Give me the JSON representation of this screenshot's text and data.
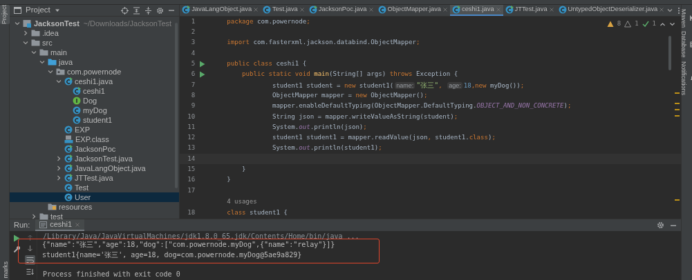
{
  "tool_stripes": {
    "left": [
      {
        "label": "Project",
        "selected": true
      }
    ],
    "bottom_left": "marks",
    "right": [
      {
        "label": "Maven",
        "kind": "maven"
      },
      {
        "label": "Database",
        "kind": "database"
      },
      {
        "label": "Notifications",
        "kind": "bell"
      }
    ]
  },
  "project_panel": {
    "title": "Project",
    "tree": [
      {
        "label": "JacksonTest",
        "path": "~/Downloads/JacksonTest",
        "kind": "module",
        "selected": false,
        "expanded": true,
        "children": [
          {
            "label": ".idea",
            "kind": "folder",
            "selected": false,
            "expanded": false
          },
          {
            "label": "src",
            "kind": "folder",
            "selected": false,
            "expanded": true,
            "children": [
              {
                "label": "main",
                "kind": "folder",
                "selected": false,
                "expanded": true,
                "children": [
                  {
                    "label": "java",
                    "kind": "source",
                    "selected": false,
                    "expanded": true,
                    "children": [
                      {
                        "label": "com.powernode",
                        "kind": "package",
                        "selected": false,
                        "expanded": true,
                        "children": [
                          {
                            "label": "ceshi1.java",
                            "kind": "runclass",
                            "selected": false,
                            "expanded": true,
                            "children": [
                              {
                                "label": "ceshi1",
                                "kind": "runclass",
                                "selected": false
                              },
                              {
                                "label": "Dog",
                                "kind": "interface",
                                "selected": false
                              },
                              {
                                "label": "myDog",
                                "kind": "class",
                                "selected": false
                              },
                              {
                                "label": "student1",
                                "kind": "class",
                                "selected": false
                              }
                            ]
                          },
                          {
                            "label": "EXP",
                            "kind": "class",
                            "selected": false
                          },
                          {
                            "label": "EXP.class",
                            "kind": "compiled",
                            "selected": false
                          },
                          {
                            "label": "JacksonPoc",
                            "kind": "runclass",
                            "selected": false
                          },
                          {
                            "label": "JacksonTest.java",
                            "kind": "runclass",
                            "selected": false,
                            "expanded": false
                          },
                          {
                            "label": "JavaLangObject.java",
                            "kind": "runclass",
                            "selected": false,
                            "expanded": false
                          },
                          {
                            "label": "JTTest.java",
                            "kind": "runclass",
                            "selected": false,
                            "expanded": false
                          },
                          {
                            "label": "Test",
                            "kind": "class",
                            "selected": false
                          },
                          {
                            "label": "User",
                            "kind": "class",
                            "selected": true
                          }
                        ]
                      }
                    ]
                  },
                  {
                    "label": "resources",
                    "kind": "resources",
                    "selected": false
                  }
                ]
              },
              {
                "label": "test",
                "kind": "folder",
                "selected": false,
                "expanded": false
              }
            ]
          }
        ]
      }
    ]
  },
  "editor": {
    "tabs": [
      {
        "label": "JavaLangObject.java",
        "kind": "runclass",
        "selected": false
      },
      {
        "label": "Test.java",
        "kind": "class",
        "selected": false
      },
      {
        "label": "JacksonPoc.java",
        "kind": "runclass",
        "selected": false
      },
      {
        "label": "ObjectMapper.java",
        "kind": "class",
        "selected": false
      },
      {
        "label": "ceshi1.java",
        "kind": "runclass",
        "selected": true
      },
      {
        "label": "JTTest.java",
        "kind": "runclass",
        "selected": false
      },
      {
        "label": "UntypedObjectDeserializer.java",
        "kind": "class",
        "selected": false
      }
    ],
    "inspections": [
      {
        "kind": "warning",
        "count": "8"
      },
      {
        "kind": "weak",
        "count": "1"
      },
      {
        "kind": "ok",
        "count": "1"
      }
    ],
    "lines": [
      {
        "number": "1",
        "tokens": [
          {
            "kind": "kw",
            "t": "package"
          },
          {
            "kind": "plain",
            "t": " com.powernode"
          },
          {
            "kind": "kw",
            "t": ";"
          }
        ]
      },
      {
        "number": "2"
      },
      {
        "number": "3",
        "tokens": [
          {
            "kind": "kw",
            "t": "import"
          },
          {
            "kind": "plain",
            "t": " com.fasterxml.jackson.databind.ObjectMapper"
          },
          {
            "kind": "kw",
            "t": ";"
          }
        ]
      },
      {
        "number": "4"
      },
      {
        "number": "5",
        "run": true,
        "tokens": [
          {
            "kind": "kw",
            "t": "public class "
          },
          {
            "kind": "plain",
            "t": "ceshi1 {"
          }
        ]
      },
      {
        "number": "6",
        "run": true,
        "tokens": [
          {
            "kind": "kw",
            "t": "    public static void "
          },
          {
            "kind": "method",
            "t": "main"
          },
          {
            "kind": "plain",
            "t": "(String[] args) "
          },
          {
            "kind": "kw",
            "t": "throws "
          },
          {
            "kind": "plain",
            "t": "Exception {"
          }
        ]
      },
      {
        "number": "7",
        "tokens": [
          {
            "kind": "plain",
            "t": "            student1 student = "
          },
          {
            "kind": "kw",
            "t": "new "
          },
          {
            "kind": "plain",
            "t": "student1("
          },
          {
            "kind": "hint",
            "t": "name:"
          },
          {
            "kind": "str",
            "t": "\"张三\""
          },
          {
            "kind": "kw",
            "t": ", "
          },
          {
            "kind": "hint",
            "t": "age:"
          },
          {
            "kind": "num",
            "t": "18"
          },
          {
            "kind": "kw",
            "t": ",new "
          },
          {
            "kind": "plain",
            "t": "myDog())"
          },
          {
            "kind": "kw",
            "t": ";"
          }
        ]
      },
      {
        "number": "8",
        "tokens": [
          {
            "kind": "plain",
            "t": "            ObjectMapper mapper = "
          },
          {
            "kind": "kw",
            "t": "new "
          },
          {
            "kind": "plain",
            "t": "ObjectMapper()"
          },
          {
            "kind": "kw",
            "t": ";"
          }
        ]
      },
      {
        "number": "9",
        "tokens": [
          {
            "kind": "plain",
            "t": "            mapper.enableDefaultTyping(ObjectMapper.DefaultTyping."
          },
          {
            "kind": "field",
            "t": "OBJECT_AND_NON_CONCRETE"
          },
          {
            "kind": "plain",
            "t": ")"
          },
          {
            "kind": "kw",
            "t": ";"
          }
        ]
      },
      {
        "number": "10",
        "tokens": [
          {
            "kind": "plain",
            "t": "            String json = mapper.writeValueAsString(student)"
          },
          {
            "kind": "kw",
            "t": ";"
          }
        ]
      },
      {
        "number": "11",
        "tokens": [
          {
            "kind": "plain",
            "t": "            System."
          },
          {
            "kind": "field",
            "t": "out"
          },
          {
            "kind": "plain",
            "t": ".println(json)"
          },
          {
            "kind": "kw",
            "t": ";"
          }
        ]
      },
      {
        "number": "12",
        "tokens": [
          {
            "kind": "plain",
            "t": "            student1 student1 = mapper.readValue(json"
          },
          {
            "kind": "kw",
            "t": ","
          },
          {
            "kind": "plain",
            "t": " student1."
          },
          {
            "kind": "kw",
            "t": "class"
          },
          {
            "kind": "plain",
            "t": ")"
          },
          {
            "kind": "kw",
            "t": ";"
          }
        ]
      },
      {
        "number": "13",
        "tokens": [
          {
            "kind": "plain",
            "t": "            System."
          },
          {
            "kind": "field",
            "t": "out"
          },
          {
            "kind": "plain",
            "t": ".println(student1)"
          },
          {
            "kind": "kw",
            "t": ";"
          }
        ]
      },
      {
        "number": "14",
        "current": true
      },
      {
        "number": "15",
        "tokens": [
          {
            "kind": "plain",
            "t": "    }"
          }
        ]
      },
      {
        "number": "16",
        "tokens": [
          {
            "kind": "plain",
            "t": "}"
          }
        ]
      },
      {
        "number": "17"
      },
      {
        "kind": "usages",
        "text": "4 usages"
      },
      {
        "number": "18",
        "tokens": [
          {
            "kind": "kw",
            "t": "class "
          },
          {
            "kind": "plain",
            "t": "student1 {"
          }
        ]
      }
    ]
  },
  "run_panel": {
    "label": "Run:",
    "tabs": [
      {
        "label": "ceshi1",
        "selected": true
      }
    ],
    "output": [
      {
        "kind": "command",
        "text": "/Library/Java/JavaVirtualMachines/jdk1.8.0_65.jdk/Contents/Home/bin/java ...",
        "boxed": false
      },
      {
        "kind": "stdout",
        "text": "{\"name\":\"张三\",\"age\":18,\"dog\":[\"com.powernode.myDog\",{\"name\":\"relay\"}]}",
        "boxed": true
      },
      {
        "kind": "stdout",
        "text": "student1{name='张三', age=18, dog=com.powernode.myDog@5ae9a829}",
        "boxed": true
      },
      {
        "kind": "system",
        "text": "Process finished with exit code 0",
        "boxed": false
      }
    ]
  }
}
